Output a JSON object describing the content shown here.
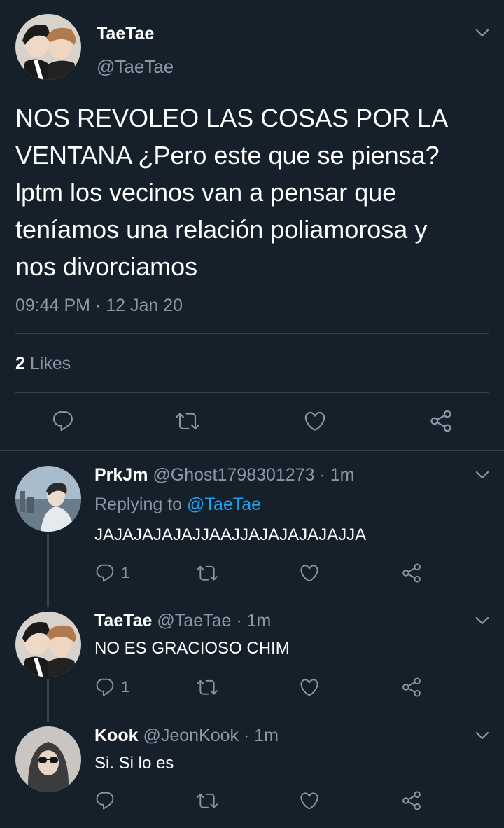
{
  "main_tweet": {
    "display_name": "TaeTae",
    "handle": "@TaeTae",
    "text": "NOS REVOLEO LAS COSAS POR LA VENTANA ¿Pero este que se piensa? lptm los vecinos van a pensar que teníamos una relación poliamorosa y nos divorciamos",
    "time": "09:44 PM",
    "separator": "·",
    "date": "12 Jan 20",
    "likes_count": "2",
    "likes_label": "Likes"
  },
  "replies": [
    {
      "display_name": "PrkJm",
      "handle": "@Ghost1798301273",
      "time": "· 1m",
      "replying_label": "Replying to",
      "replying_to": "@TaeTae",
      "text": "JAJAJAJAJAJJAAJJAJAJAJAJAJJA",
      "reply_count": "1"
    },
    {
      "display_name": "TaeTae",
      "handle": "@TaeTae",
      "time": "· 1m",
      "text": "NO ES GRACIOSO CHIM",
      "reply_count": "1"
    },
    {
      "display_name": "Kook",
      "handle": "@JeonKook",
      "time": "· 1m",
      "text": "Si. Si lo es",
      "reply_count": ""
    }
  ],
  "icons": [
    "chevron-down-icon",
    "reply-icon",
    "retweet-icon",
    "like-icon",
    "share-icon"
  ],
  "colors": {
    "background": "#15202b",
    "text": "#ffffff",
    "muted": "#8899a6",
    "accent": "#1da1f2",
    "divider": "#38444d"
  }
}
